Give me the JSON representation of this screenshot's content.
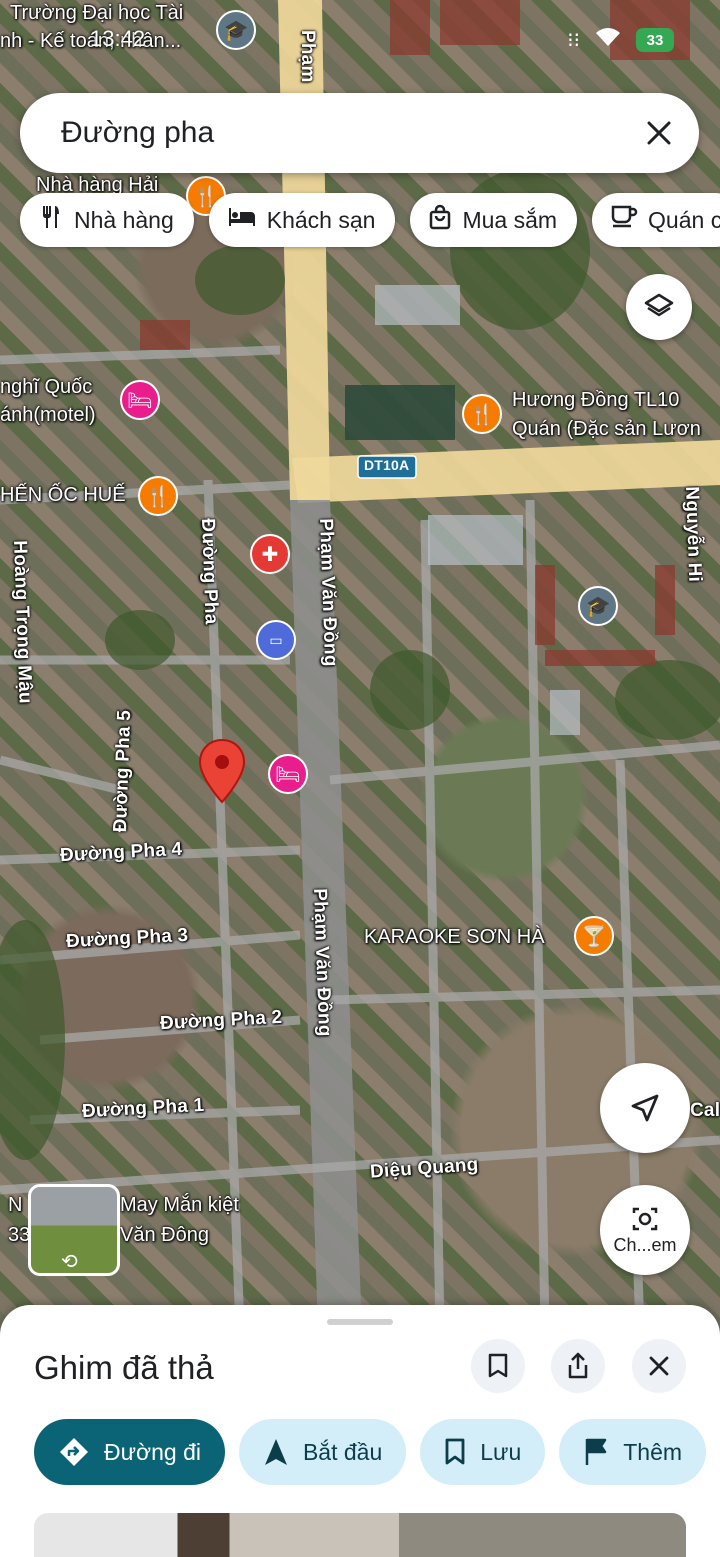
{
  "status_bar": {
    "time": "13:42",
    "battery": "33"
  },
  "search": {
    "query": "Đường pha"
  },
  "chips": [
    {
      "label": "Nhà hàng",
      "icon": "restaurant-icon"
    },
    {
      "label": "Khách sạn",
      "icon": "hotel-icon"
    },
    {
      "label": "Mua sắm",
      "icon": "shopping-icon"
    },
    {
      "label": "Quán c",
      "icon": "coffee-icon"
    }
  ],
  "map": {
    "streets": {
      "pham_van_dong_top": "Phạm",
      "pham_van_dong_1": "Phạm Văn Đồng",
      "pham_van_dong_2": "Phạm Văn Đồng",
      "duong_pha": "Đường Pha",
      "duong_pha_5": "Đường Pha 5",
      "duong_pha_4": "Đường Pha 4",
      "duong_pha_3": "Đường Pha 3",
      "duong_pha_2": "Đường Pha 2",
      "duong_pha_1": "Đường Pha 1",
      "dieu_quang": "Diệu Quang",
      "dt10a": "DT10A",
      "nguyen_right": "Nguyễn Hi",
      "trong_mau": "Hoàng Trọng Mậu",
      "cal": "Cal",
      "oc": "oc"
    },
    "places": {
      "truong_dai_hoc_1": "Trường Đại học Tài",
      "truong_dai_hoc_2": "nh - Kế toán, nhân...",
      "nha_hang_hai": "Nhà hàng Hải",
      "nghi_quoc_1": "nghĩ Quốc",
      "nghi_quoc_2": "ánh(motel)",
      "huong_dong_1": "Hương Đồng TL10",
      "huong_dong_2": "Quán (Đặc sản Lươn",
      "oc_hue": "HẾN ỐC HUẾ",
      "karaoke": "KARAOKE SƠN HÀ",
      "may_man_1": "May Mắn kiệt",
      "may_man_2": "Văn Đông",
      "n_left": "N",
      "n_left_2": "33"
    },
    "camera_button_label": "Ch...em"
  },
  "sheet": {
    "title": "Ghim đã thả",
    "actions": [
      {
        "label": "Đường đi",
        "style": "primary"
      },
      {
        "label": "Bắt đầu",
        "style": "secondary"
      },
      {
        "label": "Lưu",
        "style": "secondary"
      },
      {
        "label": "Thêm",
        "style": "secondary"
      }
    ]
  },
  "colors": {
    "accent_teal": "#0b6475",
    "chip_bg": "#d3eef8",
    "pin_red": "#ea4335",
    "road_yellow": "#f3dca0",
    "poi_orange": "#f57c00",
    "poi_pink": "#e91e8c",
    "poi_blue": "#4f6bd9"
  }
}
